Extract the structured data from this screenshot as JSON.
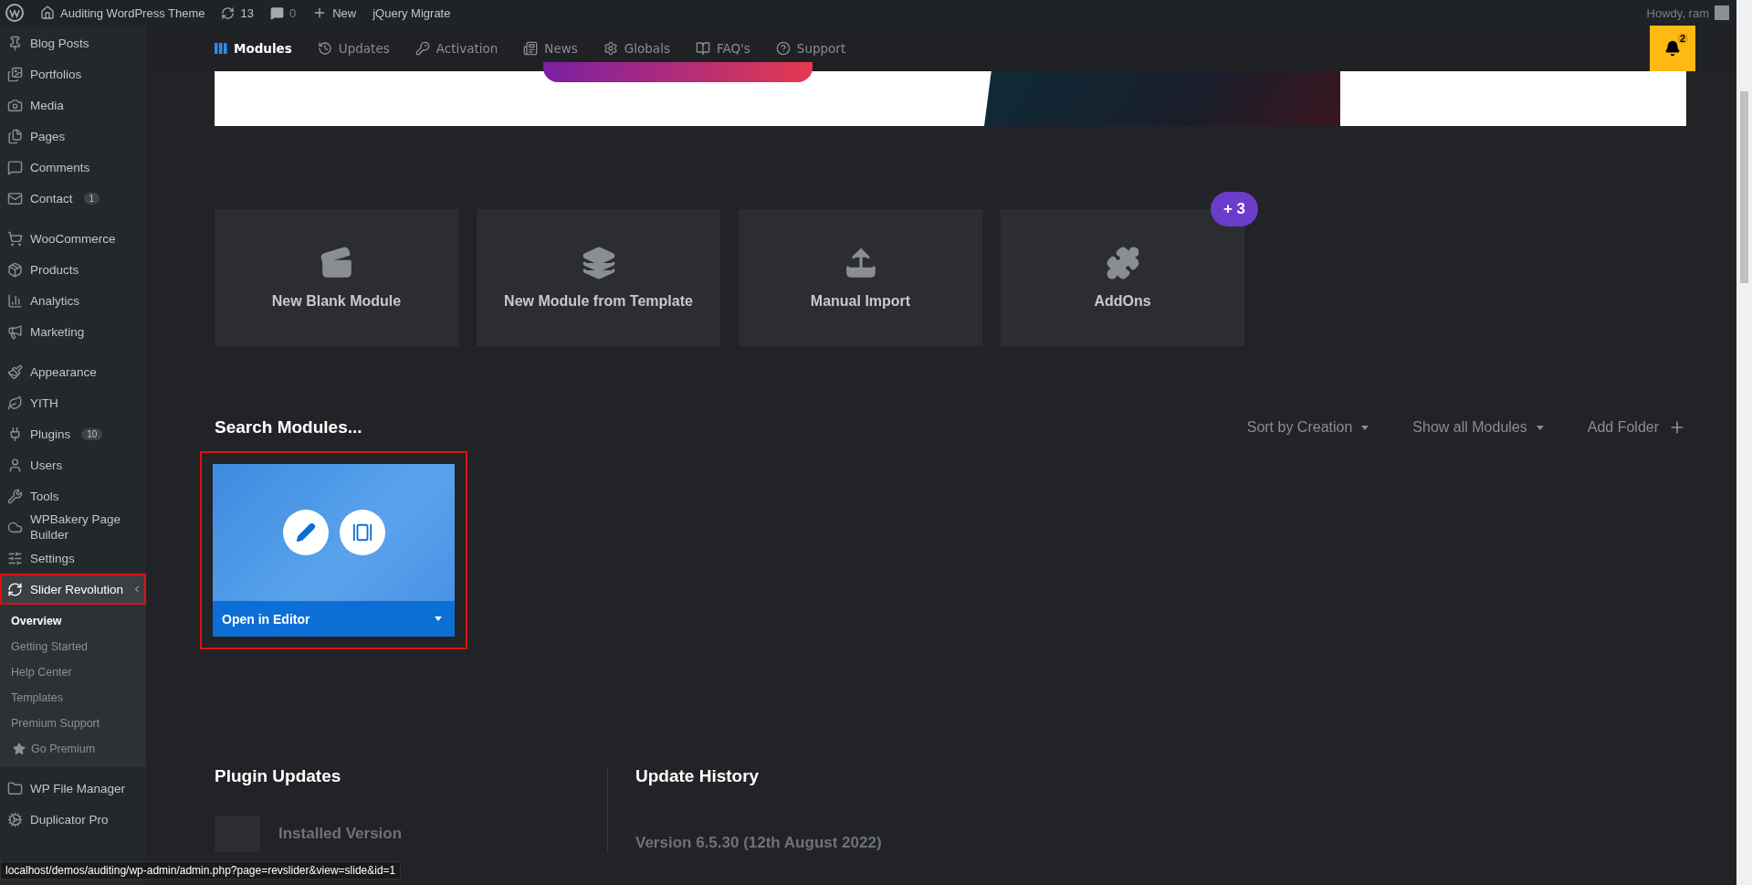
{
  "admin_bar": {
    "site_title": "Auditing WordPress Theme",
    "updates_count": "13",
    "comments_count": "0",
    "new_label": "New",
    "plugin_label": "jQuery Migrate",
    "greeting": "Howdy, ram"
  },
  "sidebar": {
    "groups": [
      {
        "items": [
          {
            "label": "Blog Posts",
            "selected": false
          },
          {
            "label": "Portfolios",
            "selected": false
          },
          {
            "label": "Media",
            "selected": false
          },
          {
            "label": "Pages",
            "selected": false
          },
          {
            "label": "Comments",
            "selected": false
          },
          {
            "label": "Contact",
            "badge": "1",
            "selected": false
          }
        ]
      },
      {
        "items": [
          {
            "label": "WooCommerce",
            "selected": false
          },
          {
            "label": "Products",
            "selected": false
          },
          {
            "label": "Analytics",
            "selected": false
          },
          {
            "label": "Marketing",
            "selected": false
          }
        ]
      },
      {
        "items": [
          {
            "label": "Appearance",
            "selected": false
          },
          {
            "label": "YITH",
            "selected": false
          },
          {
            "label": "Plugins",
            "badge": "10",
            "selected": false
          },
          {
            "label": "Users",
            "selected": false
          },
          {
            "label": "Tools",
            "selected": false
          },
          {
            "label": "WPBakery Page Builder",
            "selected": false
          },
          {
            "label": "Settings",
            "selected": false
          },
          {
            "label": "Slider Revolution",
            "selected": true,
            "highlighted": true,
            "children": [
              {
                "label": "Overview",
                "selected": true
              },
              {
                "label": "Getting Started",
                "selected": false
              },
              {
                "label": "Help Center",
                "selected": false
              },
              {
                "label": "Templates",
                "selected": false
              },
              {
                "label": "Premium Support",
                "selected": false
              },
              {
                "label": "Go Premium",
                "kind": "premium",
                "selected": false
              }
            ]
          },
          {
            "label": "WP File Manager",
            "selected": false
          },
          {
            "label": "Duplicator Pro",
            "selected": false
          }
        ]
      }
    ]
  },
  "nav_tabs": [
    {
      "label": "Modules",
      "selected": true
    },
    {
      "label": "Updates",
      "selected": false
    },
    {
      "label": "Activation",
      "selected": false
    },
    {
      "label": "News",
      "selected": false
    },
    {
      "label": "Globals",
      "selected": false
    },
    {
      "label": "FAQ's",
      "selected": false
    },
    {
      "label": "Support",
      "selected": false
    }
  ],
  "notifications": {
    "count": "2"
  },
  "actions": [
    {
      "label": "New Blank Module"
    },
    {
      "label": "New Module from Template"
    },
    {
      "label": "Manual Import"
    },
    {
      "label": "AddOns",
      "badge": "+ 3"
    }
  ],
  "modules_header": {
    "title": "Search Modules...",
    "sort": "Sort by Creation",
    "filter": "Show all Modules",
    "add": "Add Folder"
  },
  "modules": [
    {
      "action": "Open in Editor",
      "highlighted": true
    }
  ],
  "plugin_updates": {
    "title": "Plugin Updates",
    "installed_label": "Installed Version"
  },
  "update_history": {
    "title": "Update History",
    "version": "Version 6.5.30 (12th August 2022)"
  },
  "status_url": "localhost/demos/auditing/wp-admin/admin.php?page=revslider&view=slide&id=1"
}
